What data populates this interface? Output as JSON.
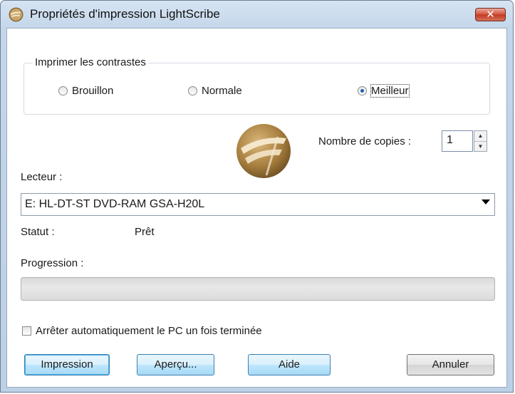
{
  "window": {
    "title": "Propriétés d'impression LightScribe",
    "close_label": "✕"
  },
  "contrast": {
    "group_title": "Imprimer les contrastes",
    "options": [
      "Brouillon",
      "Normale",
      "Meilleur"
    ],
    "selected": "Meilleur"
  },
  "copies": {
    "label": "Nombre de copies :",
    "value": "1"
  },
  "drive": {
    "label": "Lecteur :",
    "selected": "E: HL-DT-ST DVD-RAM GSA-H20L"
  },
  "status": {
    "label": "Statut :",
    "value": "Prêt"
  },
  "progress": {
    "label": "Progression :",
    "value": 0
  },
  "shutdown": {
    "label": "Arrêter automatiquement le PC un fois terminée",
    "checked": false
  },
  "buttons": {
    "print": "Impression",
    "preview": "Aperçu...",
    "help": "Aide",
    "cancel": "Annuler"
  },
  "colors": {
    "accent": "#3c7fb1",
    "close": "#c13a22"
  }
}
